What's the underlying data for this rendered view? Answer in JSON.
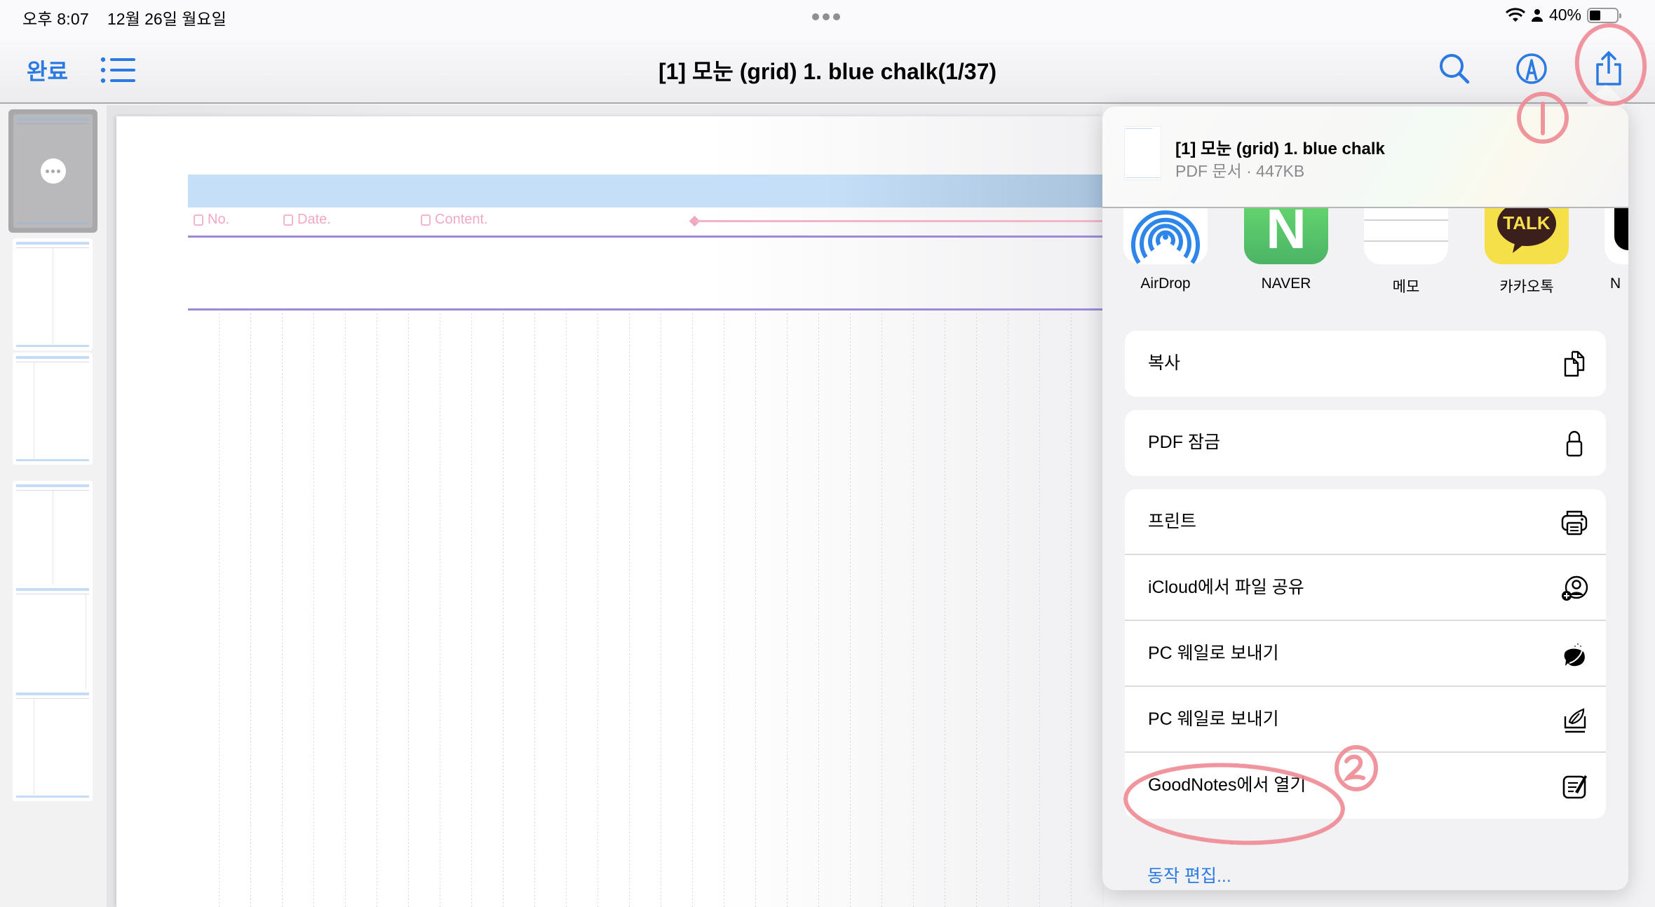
{
  "status_bar": {
    "time": "오후 8:07",
    "date": "12월 26일 월요일",
    "battery_percent_label": "40%",
    "battery_level": 0.4,
    "icons": [
      "wifi-icon",
      "person-icon",
      "battery-icon"
    ]
  },
  "nav": {
    "done_label": "완료",
    "title": "[1] 모눈 (grid) 1. blue chalk(1/37)",
    "left_icons": [
      "list-icon"
    ],
    "right_icons": [
      "search-icon",
      "markup-icon",
      "share-icon"
    ]
  },
  "sidebar": {
    "thumbnails": [
      {
        "page": 1,
        "selected": true,
        "more_icon": "ellipsis-icon"
      },
      {
        "page": 2,
        "selected": false
      },
      {
        "page": 3,
        "selected": false
      },
      {
        "page": 4,
        "selected": false
      },
      {
        "page": 5,
        "selected": false
      },
      {
        "page": 6,
        "selected": false
      }
    ]
  },
  "document": {
    "header_fields": [
      "No.",
      "Date.",
      "Content."
    ],
    "colors": {
      "band": "#c5dff9",
      "field_text": "#f2a9c3",
      "rule": "#9b8ad8"
    }
  },
  "share_sheet": {
    "file_name": "[1] 모눈 (grid) 1. blue chalk",
    "file_meta": "PDF 문서 · 447KB",
    "apps": [
      {
        "label": "AirDrop",
        "icon": "airdrop-icon"
      },
      {
        "label": "NAVER",
        "icon": "naver-icon",
        "glyph": "N"
      },
      {
        "label": "메모",
        "icon": "notes-icon"
      },
      {
        "label": "카카오톡",
        "icon": "kakaotalk-icon",
        "glyph": "TALK"
      },
      {
        "label": "N",
        "icon": "app-icon-partial"
      }
    ],
    "actions_group1": [
      {
        "label": "복사",
        "icon": "copy-icon"
      }
    ],
    "actions_group2": [
      {
        "label": "PDF 잠금",
        "icon": "lock-icon"
      }
    ],
    "actions_group3": [
      {
        "label": "프린트",
        "icon": "printer-icon"
      },
      {
        "label": "iCloud에서 파일 공유",
        "icon": "person-add-icon"
      },
      {
        "label": "PC 웨일로 보내기",
        "icon": "whale-icon"
      },
      {
        "label": "PC 웨일로 보내기",
        "icon": "whale-send-icon"
      },
      {
        "label": "GoodNotes에서 열기",
        "icon": "goodnotes-icon"
      }
    ],
    "edit_actions_label": "동작 편집..."
  },
  "annotations": [
    {
      "label": "1",
      "target": "share-button",
      "color": "#ef8a92"
    },
    {
      "label": "2",
      "target": "goodnotes-action",
      "color": "#ef8a92"
    }
  ]
}
